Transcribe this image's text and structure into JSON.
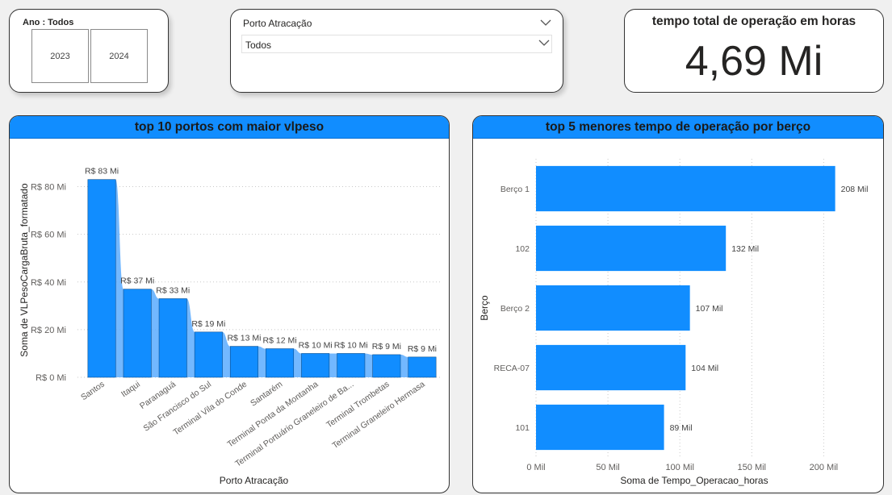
{
  "year_slicer": {
    "title": "Ano : Todos",
    "options": [
      "2023",
      "2024"
    ]
  },
  "porto_slicer": {
    "title": "Porto Atracação",
    "selected": "Todos"
  },
  "kpi": {
    "title": "tempo total de operação em horas",
    "value": "4,69 Mi"
  },
  "colors": {
    "accent": "#118dff",
    "ribbon": "#5aabff",
    "header": "#118dff"
  },
  "icons": [
    "chevron-down-icon"
  ],
  "chart_data": [
    {
      "type": "bar",
      "title": "top 10 portos com maior vlpeso",
      "xlabel": "Porto Atracação",
      "ylabel": "Soma de VLPesoCargaBruta_formatado",
      "ylim": [
        0,
        90
      ],
      "yticks": [
        0,
        20,
        40,
        60,
        80
      ],
      "ytick_labels": [
        "R$ 0 Mi",
        "R$ 20 Mi",
        "R$ 40 Mi",
        "R$ 60 Mi",
        "R$ 80 Mi"
      ],
      "grid": true,
      "categories": [
        "Santos",
        "Itaqui",
        "Paranaguá",
        "São Francisco do Sul",
        "Terminal Vila do Conde",
        "Santarém",
        "Terminal Ponta da Montanha",
        "Terminal Portuário Graneleiro de Ba...",
        "Terminal Trombetas",
        "Terminal Graneleiro Hermasa"
      ],
      "values": [
        83,
        37,
        33,
        19,
        13,
        12,
        10,
        10,
        9.5,
        8.5
      ],
      "data_labels": [
        "R$ 83 Mi",
        "R$ 37 Mi",
        "R$ 33 Mi",
        "R$ 19 Mi",
        "R$ 13 Mi",
        "R$ 12 Mi",
        "R$ 10 Mi",
        "R$ 10 Mi",
        "R$ 9 Mi",
        "R$ 9 Mi"
      ],
      "ribbon": true
    },
    {
      "type": "bar",
      "orientation": "horizontal",
      "title": "top 5 menores tempo de operação por berço",
      "xlabel": "Soma de Tempo_Operacao_horas",
      "ylabel": "Berço",
      "xlim": [
        0,
        220
      ],
      "xticks": [
        0,
        50,
        100,
        150,
        200
      ],
      "xtick_labels": [
        "0 Mil",
        "50 Mil",
        "100 Mil",
        "150 Mil",
        "200 Mil"
      ],
      "grid": true,
      "categories": [
        "Berço 1",
        "102",
        "Berço 2",
        "RECA-07",
        "101"
      ],
      "values": [
        208,
        132,
        107,
        104,
        89
      ],
      "data_labels": [
        "208 Mil",
        "132 Mil",
        "107 Mil",
        "104 Mil",
        "89 Mil"
      ]
    }
  ]
}
